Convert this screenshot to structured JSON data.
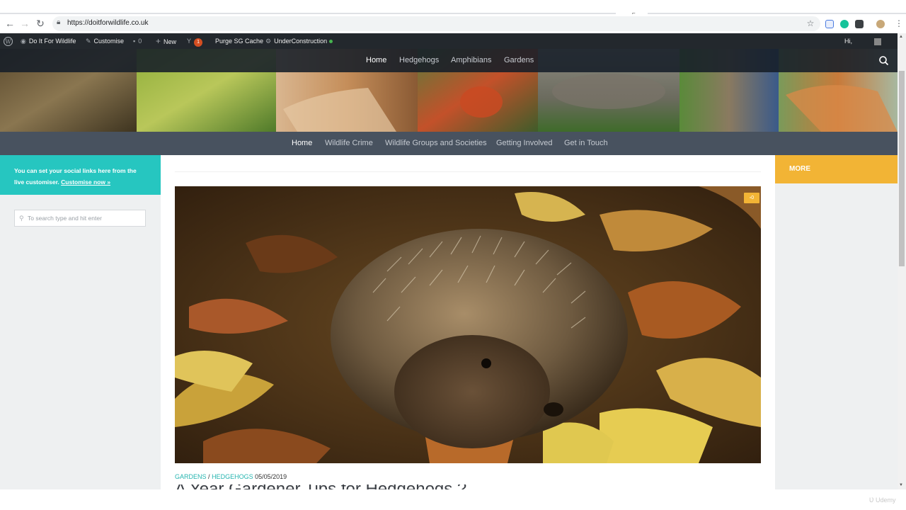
{
  "browser": {
    "url": "https://doitforwildlife.co.uk",
    "back_icon": "arrow-left-icon",
    "forward_icon": "arrow-right-icon",
    "reload_icon": "reload-icon"
  },
  "adminbar": {
    "site_name": "Do It For Wildlife",
    "customise": "Customise",
    "comments_count": "0",
    "new_label": "New",
    "updates_count": "1",
    "purge_label": "Purge SG Cache",
    "under_construction": "UnderConstruction",
    "greeting": "Hi,"
  },
  "topnav": {
    "items": [
      "Home",
      "Hedgehogs",
      "Amphibians",
      "Gardens"
    ]
  },
  "subnav": {
    "items": [
      "Home",
      "Wildlife Crime",
      "Wildlife Groups and Societies",
      "Getting Involved",
      "Get in Touch"
    ]
  },
  "sidebar": {
    "social_text": "You can set your social links here from the live customiser.",
    "social_link": "Customise now »",
    "search_placeholder": "To search type and hit enter"
  },
  "right_sidebar": {
    "more_label": "MORE"
  },
  "post": {
    "comment_count": "0",
    "category1": "GARDENS",
    "separator": "/",
    "category2": "HEDGEHOGS",
    "date": "05/05/2019",
    "title": "A Year Gardener Tips for Hedgehogs ?"
  },
  "watermark": "Udemy",
  "colors": {
    "teal": "#26c6c0",
    "orange": "#f2b435",
    "nav_dark": "#48525f",
    "admin_bar": "#23282d"
  }
}
